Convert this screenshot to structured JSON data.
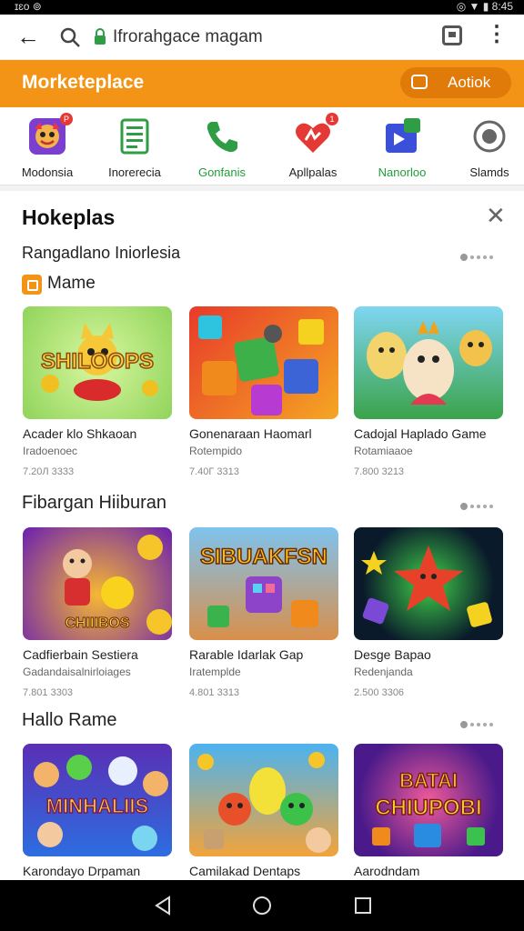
{
  "status": {
    "left": "ɪɛo  ⊚",
    "right": "◎ ▼ ▮ 8:45"
  },
  "browser": {
    "url": "Ifrorahgace magam"
  },
  "header": {
    "title": "Morketeplace",
    "action_label": "Aotiok"
  },
  "categories": [
    {
      "label": "Modonsia",
      "icon": "game-avatar-icon",
      "badge": "P"
    },
    {
      "label": "Inorerecia",
      "icon": "list-document-icon"
    },
    {
      "label": "Gonfanis",
      "icon": "phone-icon"
    },
    {
      "label": "Apllpalas",
      "icon": "heart-app-icon",
      "badge": "1"
    },
    {
      "label": "Nanorloo",
      "icon": "media-tile-icon"
    },
    {
      "label": "Slamds",
      "icon": "compass-icon"
    }
  ],
  "panel": {
    "title": "Hokeplas"
  },
  "sections": [
    {
      "title": "Rangadlano Iniorlesia",
      "sub_label": "Mame",
      "cards": [
        {
          "name": "Acader klo Shkaoan",
          "dev": "Iradoenoec",
          "meta": "7.20Л  3333",
          "thumb": "shiloops"
        },
        {
          "name": "Gonenaraan Haomarl",
          "dev": "Rotempido",
          "meta": "7.40Г  3313",
          "thumb": "cubes"
        },
        {
          "name": "Cadojal Haplado Game",
          "dev": "Rotamiaaoe",
          "meta": "7.800  3213",
          "thumb": "creatures"
        }
      ]
    },
    {
      "title": "Fibargan Hiiburan",
      "cards": [
        {
          "name": "Cadfierbain Sestiera",
          "dev": "Gadandaisalnirloiages",
          "meta": "7.801  3303",
          "thumb": "coins"
        },
        {
          "name": "Rarable Idarlak Gap",
          "dev": "Iratemplde",
          "meta": "4.801  3313",
          "thumb": "sibukfsn"
        },
        {
          "name": "Desge Bapao",
          "dev": "Redenjanda",
          "meta": "2.500  3306",
          "thumb": "starfish"
        }
      ]
    },
    {
      "title": "Hallo Rame",
      "cards": [
        {
          "name": "Karondayo Drpaman",
          "thumb": "minhaliis"
        },
        {
          "name": "Camilakad Dentaps",
          "thumb": "critters"
        },
        {
          "name": "Aarodndam",
          "thumb": "batai"
        }
      ]
    }
  ],
  "thumb_texts": {
    "shiloops": "SHILOOPS",
    "sibukfsn": "SIBUAKFSN",
    "minhaliis": "MINHALIIS",
    "batai": "BATAI CHIUPOBI",
    "coins": "CHIIIBOS"
  },
  "colors": {
    "accent": "#f39417",
    "accent_dark": "#e07b0a",
    "green": "#1e9e3a",
    "badge_red": "#e53935"
  }
}
